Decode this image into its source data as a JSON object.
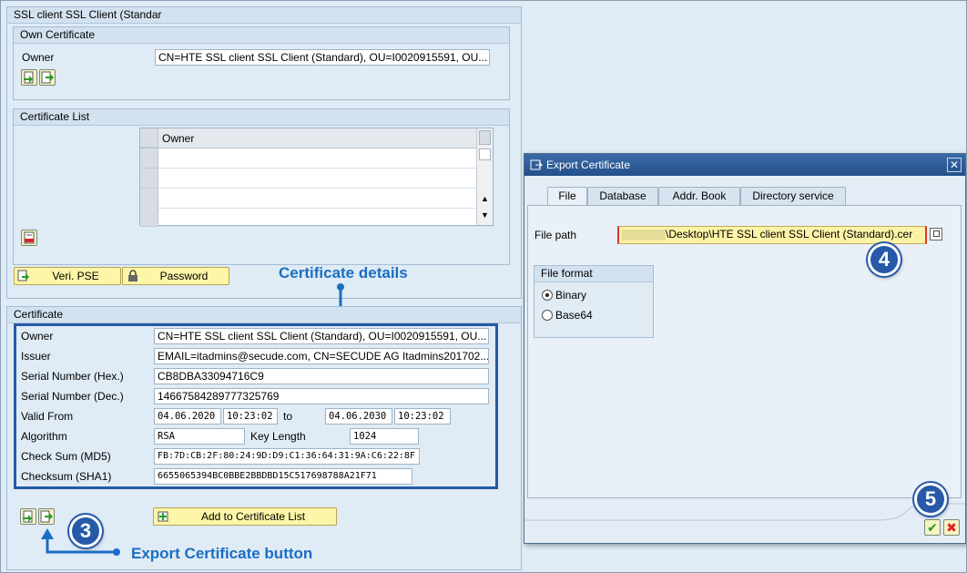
{
  "main_panel": {
    "title": "SSL client SSL Client (Standar",
    "own_certificate": {
      "title": "Own Certificate",
      "owner_label": "Owner",
      "owner_value": "CN=HTE SSL client SSL Client (Standard), OU=I0020915591, OU..."
    },
    "certificate_list": {
      "title": "Certificate List",
      "column_header": "Owner",
      "rows": [
        "",
        "",
        "",
        ""
      ]
    },
    "buttons": {
      "veri_pse": "Veri. PSE",
      "password": "Password",
      "add_to_list": "Add to Certificate List"
    },
    "certificate": {
      "title": "Certificate",
      "fields": {
        "owner_label": "Owner",
        "owner_value": "CN=HTE SSL client SSL Client (Standard), OU=I0020915591, OU...",
        "issuer_label": "Issuer",
        "issuer_value": "EMAIL=itadmins@secude.com, CN=SECUDE AG Itadmins201702...",
        "serial_hex_label": "Serial Number (Hex.)",
        "serial_hex_value": "CB8DBA33094716C9",
        "serial_dec_label": "Serial Number (Dec.)",
        "serial_dec_value": "14667584289777325769",
        "valid_from_label": "Valid From",
        "valid_from_date": "04.06.2020",
        "valid_from_time": "10:23:02",
        "to_label": "to",
        "valid_to_date": "04.06.2030",
        "valid_to_time": "10:23:02",
        "algorithm_label": "Algorithm",
        "algorithm_value": "RSA",
        "key_length_label": "Key Length",
        "key_length_value": "1024",
        "md5_label": "Check Sum (MD5)",
        "md5_value": "FB:7D:CB:2F:80:24:9D:D9:C1:36:64:31:9A:C6:22:8F",
        "sha1_label": "Checksum (SHA1)",
        "sha1_value": "6655065394BC0BBE2BBDBD15C517698788A21F71"
      }
    }
  },
  "callouts": {
    "certificate_details": "Certificate details",
    "export_button": "Export Certificate button",
    "step3": "3",
    "step4": "4",
    "step5": "5"
  },
  "dialog": {
    "title": "Export Certificate",
    "tabs": [
      "File",
      "Database",
      "Addr. Book",
      "Directory service"
    ],
    "file_path_label": "File path",
    "file_path_value": "\\Desktop\\HTE SSL client SSL Client (Standard).cer",
    "file_format_title": "File format",
    "formats": [
      "Binary",
      "Base64"
    ],
    "selected_format": "Binary"
  },
  "colors": {
    "accent": "#1b6ec2",
    "dialog_title_bg": "#2e5d9a",
    "button_yellow": "#fdf5a7",
    "highlight_box": "#2659a7"
  }
}
